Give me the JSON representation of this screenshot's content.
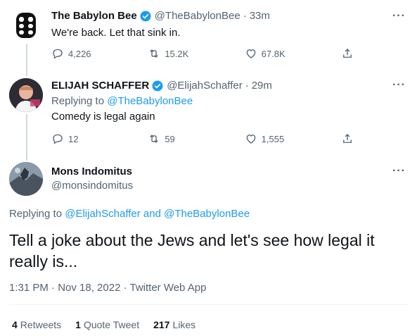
{
  "tweets": [
    {
      "name": "The Babylon Bee",
      "handle": "@TheBabylonBee",
      "time": "33m",
      "text": "We're back. Let that sink in.",
      "replies": "4,226",
      "retweets": "15.2K",
      "likes": "67.8K"
    },
    {
      "name": "ELIJAH SCHAFFER",
      "handle": "@ElijahSchaffer",
      "time": "29m",
      "replying_prefix": "Replying to",
      "replying_to": "@TheBabylonBee",
      "text": "Comedy is legal again",
      "replies": "12",
      "retweets": "59",
      "likes": "1,555"
    }
  ],
  "main": {
    "name": "Mons Indomitus",
    "handle": "@monsindomitus",
    "replying_prefix": "Replying to",
    "replying_to": "@ElijahSchaffer and @TheBabylonBee",
    "text": "Tell a joke about the Jews and let's see how legal it really is...",
    "timestamp": "1:31 PM · Nov 18, 2022 · Twitter Web App",
    "stats": {
      "retweets_count": "4",
      "retweets_label": "Retweets",
      "quotes_count": "1",
      "quotes_label": "Quote Tweet",
      "likes_count": "217",
      "likes_label": "Likes"
    }
  },
  "ui": {
    "more": "···",
    "dot": "·"
  },
  "colors": {
    "accent": "#1d9bf0",
    "secondary_text": "#536471",
    "thread_line": "#cfd9de"
  },
  "icons": [
    "reply-icon",
    "retweet-icon",
    "like-icon",
    "share-icon",
    "verified-icon",
    "more-icon"
  ]
}
